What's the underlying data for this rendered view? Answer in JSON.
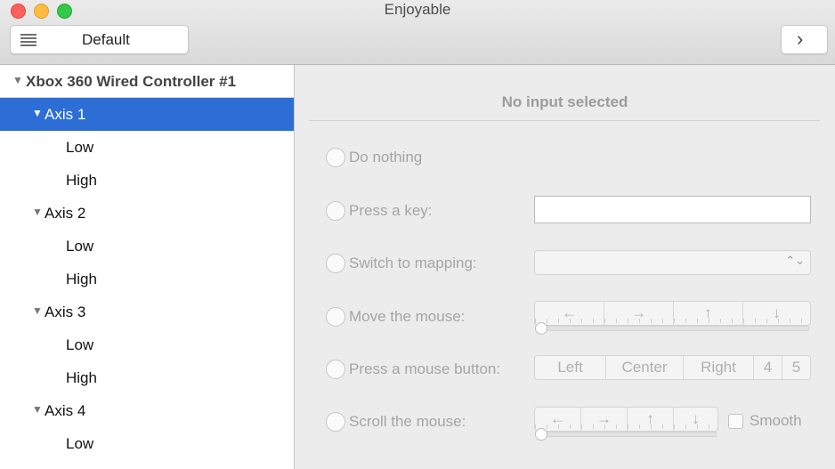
{
  "window": {
    "title": "Enjoyable"
  },
  "toolbar": {
    "mapping_label": "Default",
    "next_icon": "chevron-right-icon",
    "next_glyph": "›"
  },
  "sidebar": {
    "controller": "Xbox 360 Wired Controller #1",
    "axes": [
      {
        "label": "Axis 1",
        "expanded": true,
        "selected": true,
        "children": [
          "Low",
          "High"
        ]
      },
      {
        "label": "Axis 2",
        "expanded": true,
        "selected": false,
        "children": [
          "Low",
          "High"
        ]
      },
      {
        "label": "Axis 3",
        "expanded": true,
        "selected": false,
        "children": [
          "Low",
          "High"
        ]
      },
      {
        "label": "Axis 4",
        "expanded": true,
        "selected": false,
        "children": [
          "Low"
        ]
      }
    ]
  },
  "panel": {
    "status": "No input selected",
    "options": {
      "do_nothing": "Do nothing",
      "press_key": "Press a key:",
      "switch_mapping": "Switch to mapping:",
      "move_mouse": "Move the mouse:",
      "press_mouse_button": "Press a mouse button:",
      "scroll_mouse": "Scroll the mouse:"
    },
    "key_field_value": "",
    "mapping_popup_value": "",
    "move_directions": [
      "←",
      "→",
      "↑",
      "↓"
    ],
    "mouse_buttons": [
      "Left",
      "Center",
      "Right",
      "4",
      "5"
    ],
    "scroll_directions": [
      "←",
      "→",
      "↑",
      "↓"
    ],
    "smooth_label": "Smooth",
    "smooth_checked": false
  },
  "colors": {
    "selection": "#2c6ed6",
    "disabled_text": "#a5a5a5"
  }
}
